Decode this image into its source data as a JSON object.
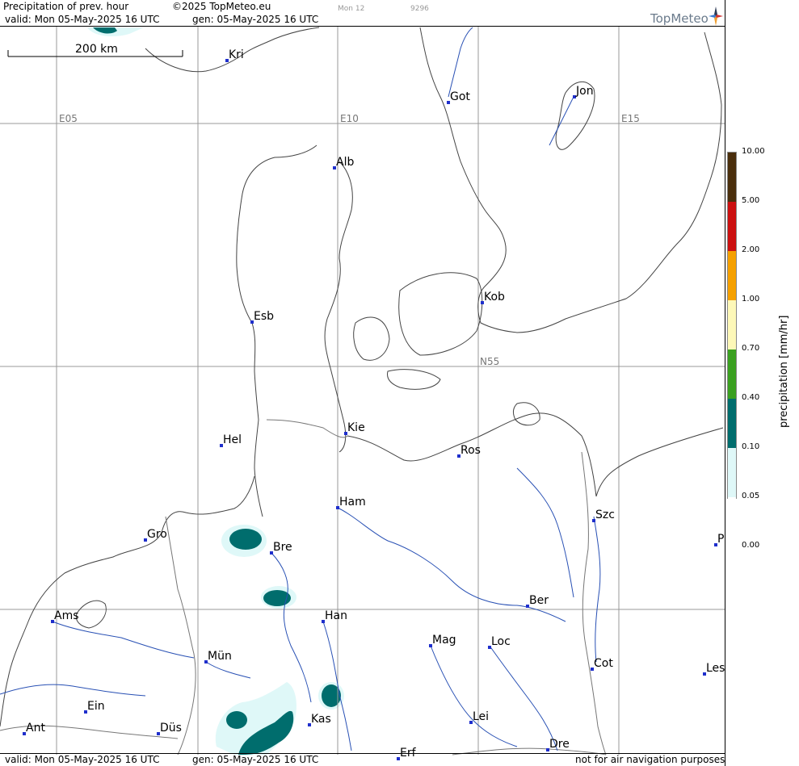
{
  "header": {
    "title": "Precipitation of prev. hour",
    "copyright": "©2025 TopMeteo.eu",
    "small_code1": "Mon 12",
    "small_code2": "9296",
    "valid_top": "valid:  Mon  05-May-2025  16 UTC",
    "gen_top": "gen: 05-May-2025 16 UTC",
    "valid_bottom": "valid:  Mon  05-May-2025  16 UTC",
    "gen_bottom": "gen: 05-May-2025 16 UTC",
    "disclaimer": "not for air navigation purposes"
  },
  "logo": {
    "text": "TopMeteo"
  },
  "scale": {
    "label": "200 km"
  },
  "grid_labels": {
    "e05": "E05",
    "e10": "E10",
    "e15": "E15",
    "n55": "N55"
  },
  "cities": [
    {
      "name": "Kri"
    },
    {
      "name": "Got"
    },
    {
      "name": "Jon"
    },
    {
      "name": "Alb"
    },
    {
      "name": "Kob"
    },
    {
      "name": "Esb"
    },
    {
      "name": "Kie"
    },
    {
      "name": "Hel"
    },
    {
      "name": "Ros"
    },
    {
      "name": "Ham"
    },
    {
      "name": "Szc"
    },
    {
      "name": "Gro"
    },
    {
      "name": "Bre"
    },
    {
      "name": "P"
    },
    {
      "name": "Ber"
    },
    {
      "name": "Ams"
    },
    {
      "name": "Han"
    },
    {
      "name": "Mag"
    },
    {
      "name": "Loc"
    },
    {
      "name": "Mün"
    },
    {
      "name": "Cot"
    },
    {
      "name": "Les"
    },
    {
      "name": "Ein"
    },
    {
      "name": "Kas"
    },
    {
      "name": "Lei"
    },
    {
      "name": "Ant"
    },
    {
      "name": "Düs"
    },
    {
      "name": "Dre"
    },
    {
      "name": "Erf"
    }
  ],
  "legend": {
    "title": "precipitation  [mm/hr]",
    "levels": [
      "10.00",
      "5.00",
      "2.00",
      "1.00",
      "0.70",
      "0.40",
      "0.10",
      "0.05",
      "0.00"
    ],
    "colors": [
      "#4a2e0c",
      "#cc1010",
      "#f5a000",
      "#fdf8b8",
      "#3aa020",
      "#006d6d",
      "#dff8f8",
      "#ffffff"
    ]
  }
}
